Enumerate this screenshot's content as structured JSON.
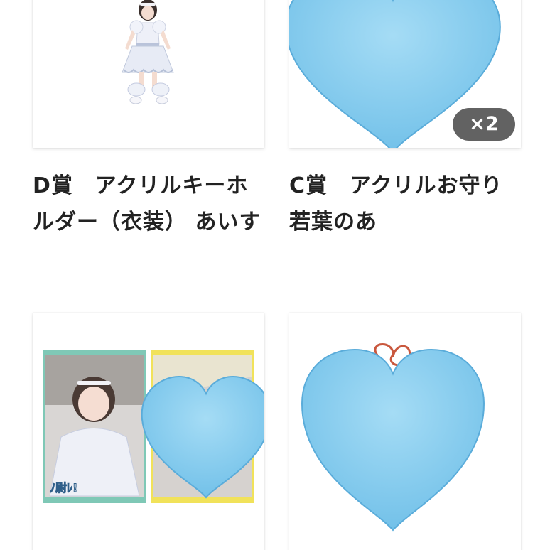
{
  "items": [
    {
      "title": "D賞　アクリルキーホルダー（衣装） あいす"
    },
    {
      "title": "C賞　アクリルお守り　若葉のあ",
      "quantity_badge": "×2"
    },
    {
      "title": ""
    },
    {
      "title": ""
    }
  ],
  "images": {
    "item1": "acrylic-keyholder-costume-photo",
    "item2": "heart-emoji-cover",
    "item3": "photo-cards-with-heart-emoji",
    "item4": "heart-emoji-with-red-string"
  },
  "colors": {
    "heart_fill": "#7cc6ec",
    "heart_light": "#a5dcf5",
    "heart_edge": "#4fa8d8",
    "badge_bg": "#464646",
    "title_text": "#222222",
    "card_bg": "#ffffff"
  }
}
